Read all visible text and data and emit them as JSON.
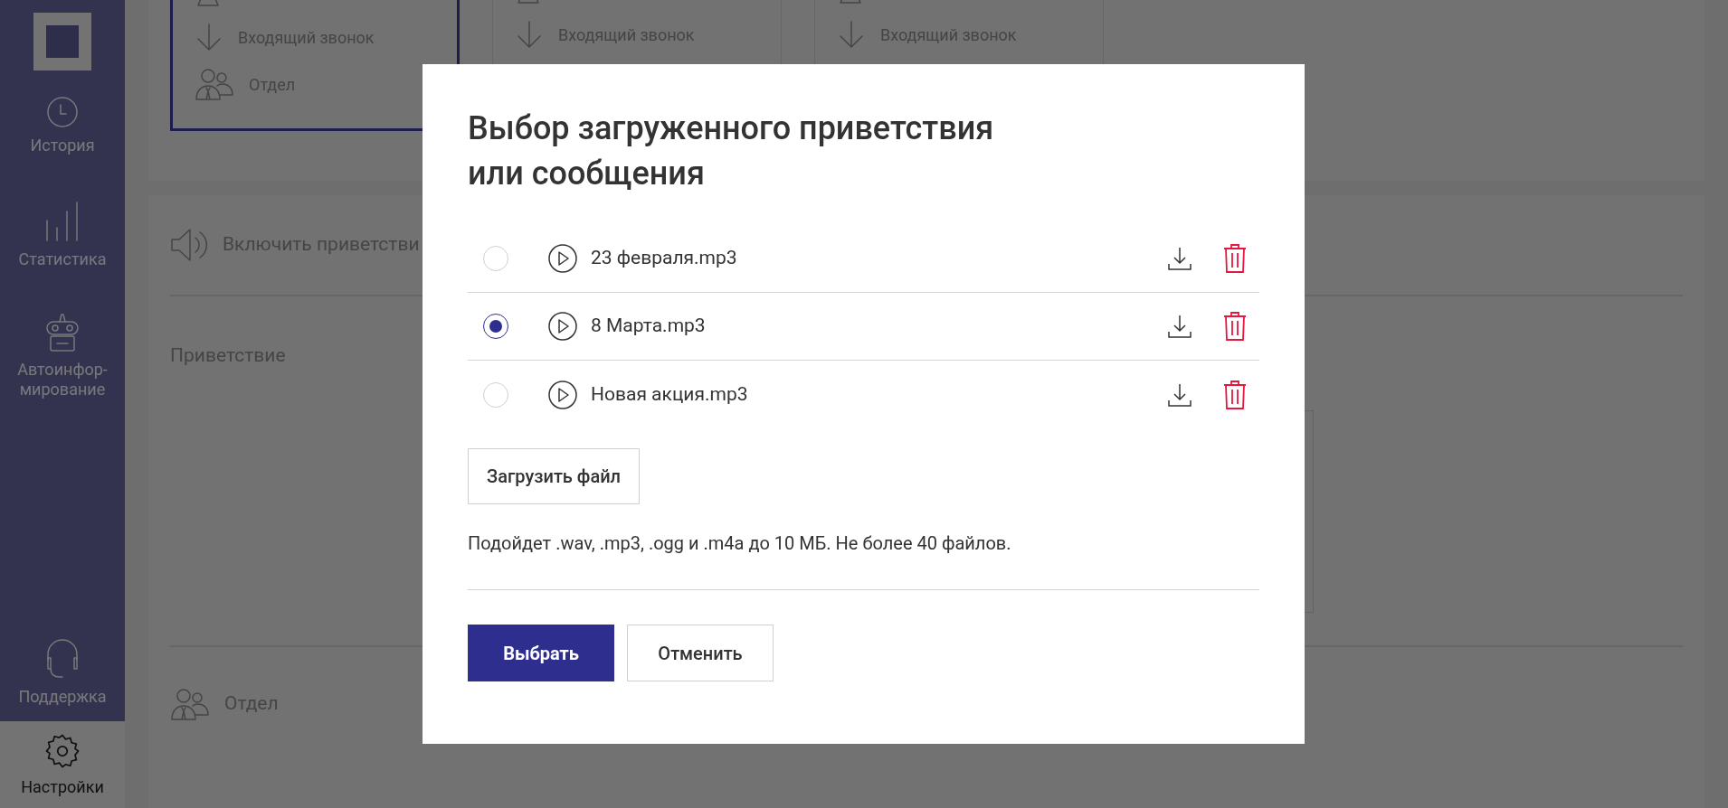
{
  "sidebar": {
    "items": [
      {
        "kind": "history",
        "label": "История",
        "selected": false
      },
      {
        "kind": "stats",
        "label": "Статистика",
        "selected": false
      },
      {
        "kind": "robot",
        "label": "Автоинфор-\nмирование",
        "selected": false
      },
      {
        "kind": "support",
        "label": "Поддержка",
        "selected": false
      },
      {
        "kind": "settings",
        "label": "Настройки",
        "selected": true
      }
    ]
  },
  "cards": [
    {
      "selected": true,
      "rows": [
        {
          "kind": "incoming",
          "label": "Входящий звонок"
        },
        {
          "kind": "department",
          "label": "Отдел"
        }
      ]
    },
    {
      "selected": false,
      "rows": [
        {
          "kind": "incoming",
          "label": "Входящий звонок"
        }
      ]
    },
    {
      "selected": false,
      "rows": [
        {
          "kind": "incoming",
          "label": "Входящий звонок"
        }
      ]
    }
  ],
  "settings": {
    "greeting_toggle": "Включить приветстви",
    "greeting_label": "Приветствие",
    "department": "Отдел"
  },
  "dialog": {
    "title": "Выбор загруженного приветствия\nили сообщения",
    "files": [
      {
        "name": "23 февраля.mp3",
        "selected": false
      },
      {
        "name": "8 Марта.mp3",
        "selected": true
      },
      {
        "name": "Новая акция.mp3",
        "selected": false
      }
    ],
    "upload_button": "Загрузить файл",
    "hint": "Подойдет .wav, .mp3, .ogg и .m4a до 10 МБ. Не более 40 файлов.",
    "confirm_button": "Выбрать",
    "cancel_button": "Отменить"
  }
}
